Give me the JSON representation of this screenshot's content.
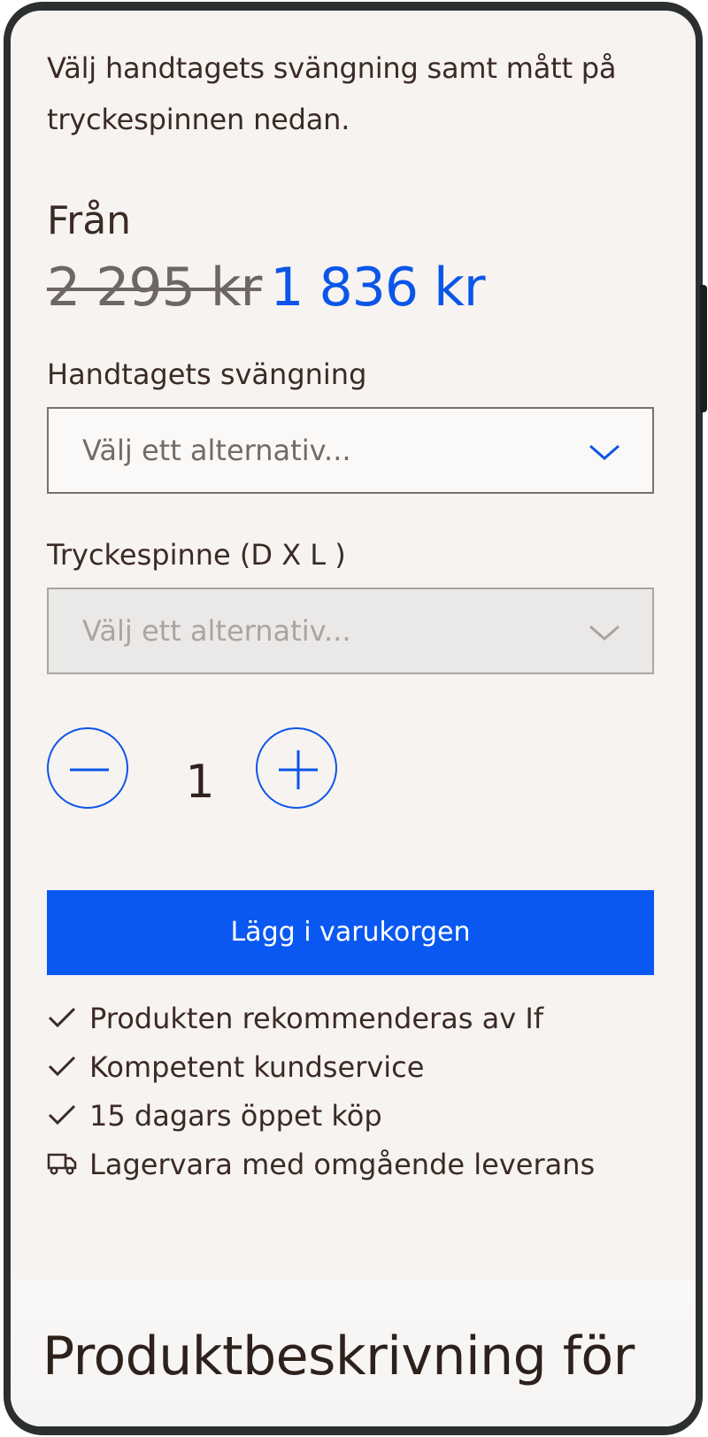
{
  "intro_text": "Välj handtagets svängning samt mått på tryckespinnen nedan.",
  "price": {
    "from_label": "Från",
    "original": "2 295 kr",
    "current": "1 836 kr"
  },
  "fields": [
    {
      "label": "Handtagets svängning",
      "placeholder": "Välj ett alternativ...",
      "disabled": false,
      "icon": "chevron-down-icon"
    },
    {
      "label": "Tryckespinne (D X L )",
      "placeholder": "Välj ett alternativ...",
      "disabled": true,
      "icon": "chevron-down-icon"
    }
  ],
  "quantity": {
    "value": "1",
    "decrement_icon": "minus-icon",
    "increment_icon": "plus-icon"
  },
  "add_to_cart_label": "Lägg i varukorgen",
  "usps": [
    {
      "icon": "checkmark-icon",
      "text": "Produkten rekommenderas av If"
    },
    {
      "icon": "checkmark-icon",
      "text": "Kompetent kundservice"
    },
    {
      "icon": "checkmark-icon",
      "text": "15 dagars öppet köp"
    },
    {
      "icon": "truck-icon",
      "text": "Lagervara med omgående leverans"
    }
  ],
  "section_title": "Produktbeskrivning för",
  "colors": {
    "accent": "#0a58f2",
    "text": "#3b2a24",
    "background": "#f6f3f1",
    "strikethrough_price": "#6e6664"
  }
}
